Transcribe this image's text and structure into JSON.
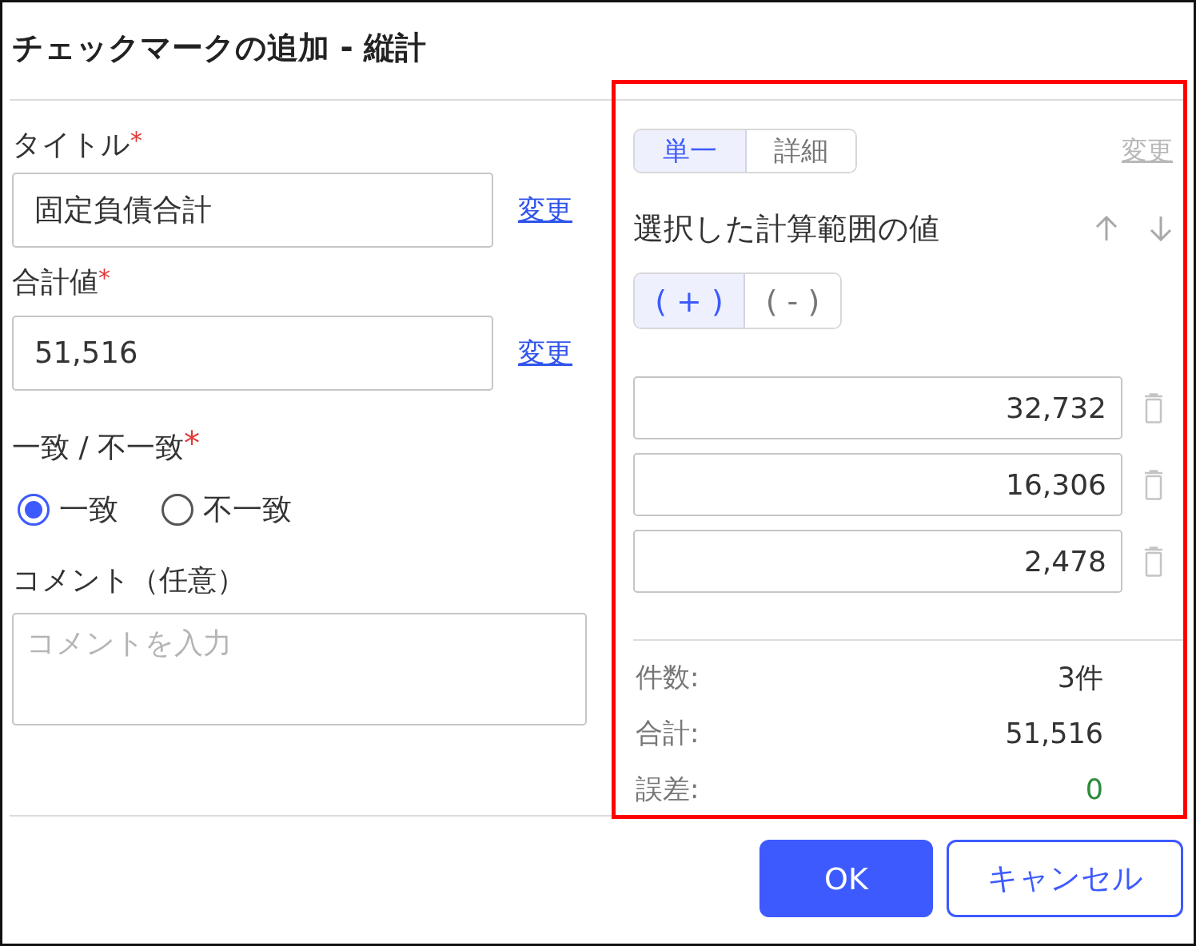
{
  "dialog": {
    "title": "チェックマークの追加 - 縦計"
  },
  "form": {
    "fields": [
      {
        "label": "タイトル",
        "required_mark": "*",
        "value": "固定負債合計",
        "link": {
          "label": "変更",
          "disabled": false
        }
      },
      {
        "label": "合計値",
        "required_mark": "*",
        "value": "51,516",
        "link": {
          "label": "変更",
          "disabled": false
        }
      }
    ],
    "match": {
      "label": "一致 / 不一致",
      "required_mark": "*",
      "options": [
        {
          "label": "一致",
          "selected": true
        },
        {
          "label": "不一致",
          "selected": false
        }
      ]
    },
    "comment": {
      "label": "コメント（任意）",
      "placeholder": "コメントを入力"
    }
  },
  "range_panel": {
    "modes": [
      {
        "label": "単一",
        "selected": true
      },
      {
        "label": "詳細",
        "selected": false
      }
    ],
    "change_link": {
      "label": "変更",
      "disabled": true
    },
    "heading": "選択した計算範囲の値",
    "signs": [
      {
        "label": "( + )",
        "selected": true
      },
      {
        "label": "( - )",
        "selected": false
      }
    ],
    "values": [
      "32,732",
      "16,306",
      "2,478"
    ],
    "summary": [
      {
        "label": "件数:",
        "value": "3件"
      },
      {
        "label": "合計:",
        "value": "51,516"
      },
      {
        "label": "誤差:",
        "value": "0",
        "color": "#2e8b3a"
      }
    ]
  },
  "buttons": [
    {
      "label": "OK",
      "kind": "primary"
    },
    {
      "label": "キャンセル",
      "kind": "secondary"
    }
  ]
}
